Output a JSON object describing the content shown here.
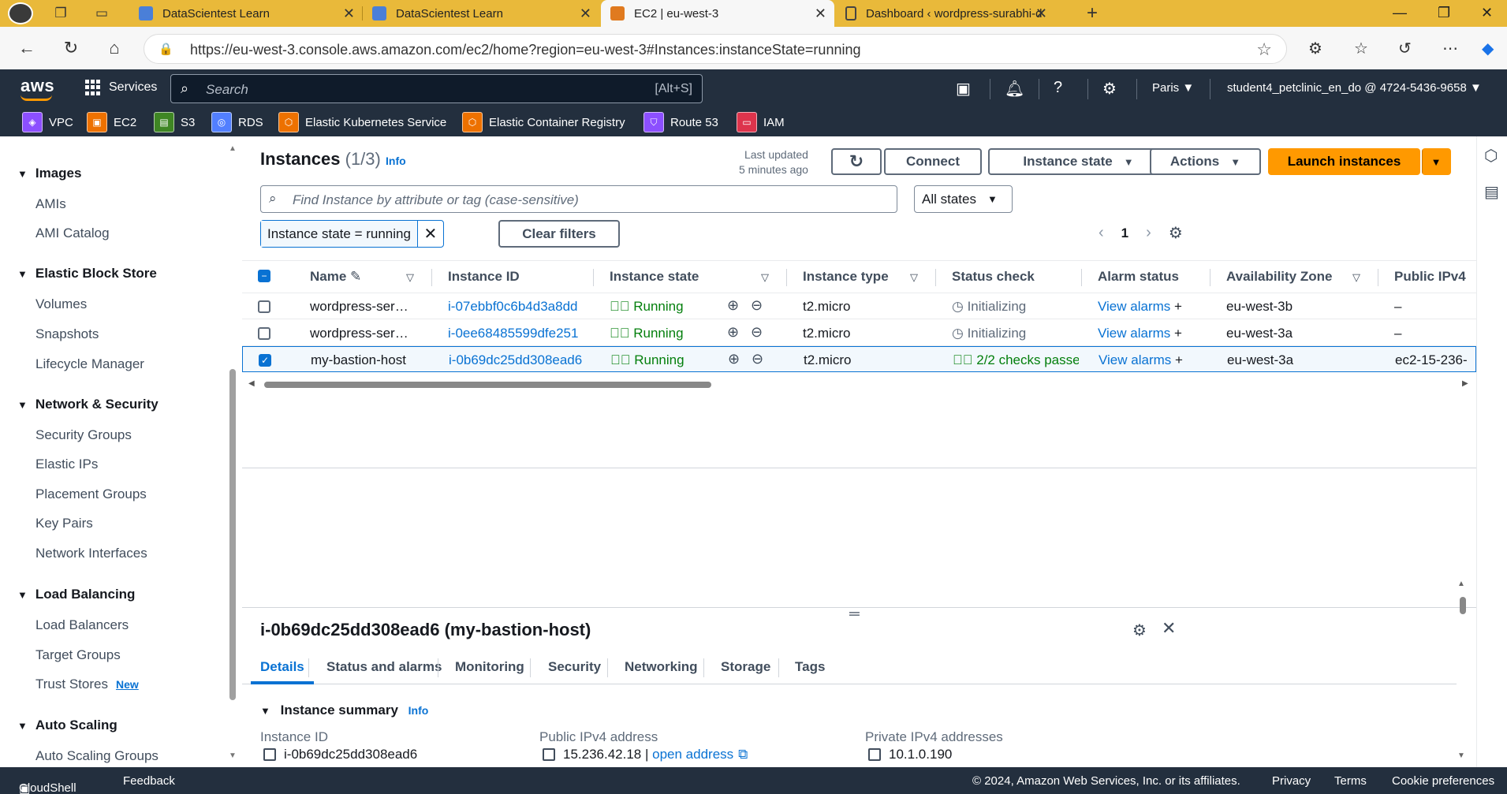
{
  "browser": {
    "tabs": [
      {
        "title": "DataScientest Learn",
        "favicon_color": "#4a7fd8"
      },
      {
        "title": "DataScientest Learn",
        "favicon_color": "#4a7fd8"
      },
      {
        "title": "EC2 | eu-west-3",
        "favicon_color": "#e07a1f"
      },
      {
        "title": "Dashboard ‹ wordpress-surabhi-d",
        "favicon_color": "#777777"
      }
    ],
    "new_tab": "+",
    "url": "https://eu-west-3.console.aws.amazon.com/ec2/home?region=eu-west-3#Instances:instanceState=running"
  },
  "aws": {
    "logo": "aws",
    "services_label": "Services",
    "search_placeholder": "Search",
    "search_shortcut": "[Alt+S]",
    "region": "Paris ▼",
    "account": "student4_petclinic_en_do @ 4724-5436-9658 ▼",
    "favorites": [
      {
        "label": "VPC",
        "color": "#8c4fff"
      },
      {
        "label": "EC2",
        "color": "#ed7100"
      },
      {
        "label": "S3",
        "color": "#3f8624"
      },
      {
        "label": "RDS",
        "color": "#527fff"
      },
      {
        "label": "Elastic Kubernetes Service",
        "color": "#ed7100"
      },
      {
        "label": "Elastic Container Registry",
        "color": "#ed7100"
      },
      {
        "label": "Route 53",
        "color": "#8c4fff"
      },
      {
        "label": "IAM",
        "color": "#dd344c"
      }
    ]
  },
  "sidebar": {
    "sections": [
      {
        "title": "Images",
        "items": [
          "AMIs",
          "AMI Catalog"
        ]
      },
      {
        "title": "Elastic Block Store",
        "items": [
          "Volumes",
          "Snapshots",
          "Lifecycle Manager"
        ]
      },
      {
        "title": "Network & Security",
        "items": [
          "Security Groups",
          "Elastic IPs",
          "Placement Groups",
          "Key Pairs",
          "Network Interfaces"
        ]
      },
      {
        "title": "Load Balancing",
        "items": [
          "Load Balancers",
          "Target Groups",
          "Trust Stores"
        ]
      },
      {
        "title": "Auto Scaling",
        "items": [
          "Auto Scaling Groups"
        ]
      }
    ],
    "new_badge": "New"
  },
  "instances": {
    "title": "Instances",
    "count": "(1/3)",
    "info": "Info",
    "last_updated_line1": "Last updated",
    "last_updated_line2": "5 minutes ago",
    "buttons": {
      "connect": "Connect",
      "instance_state": "Instance state",
      "actions": "Actions",
      "launch": "Launch instances"
    },
    "find_placeholder": "Find Instance by attribute or tag (case-sensitive)",
    "states_filter": "All states",
    "active_filter": "Instance state = running",
    "clear_filters": "Clear filters",
    "page": "1",
    "columns": [
      "Name",
      "Instance ID",
      "Instance state",
      "Instance type",
      "Status check",
      "Alarm status",
      "Availability Zone",
      "Public IPv4"
    ],
    "rows": [
      {
        "name": "wordpress-ser…",
        "id": "i-07ebbf0c6b4d3a8dd",
        "state": "Running",
        "type": "t2.micro",
        "status": "Initializing",
        "alarm": "View alarms",
        "az": "eu-west-3b",
        "ipv4": "–",
        "selected": false
      },
      {
        "name": "wordpress-ser…",
        "id": "i-0ee68485599dfe251",
        "state": "Running",
        "type": "t2.micro",
        "status": "Initializing",
        "alarm": "View alarms",
        "az": "eu-west-3a",
        "ipv4": "–",
        "selected": false
      },
      {
        "name": "my-bastion-host",
        "id": "i-0b69dc25dd308ead6",
        "state": "Running",
        "type": "t2.micro",
        "status": "2/2 checks passec",
        "alarm": "View alarms",
        "az": "eu-west-3a",
        "ipv4": "ec2-15-236-",
        "selected": true
      }
    ]
  },
  "details": {
    "title": "i-0b69dc25dd308ead6 (my-bastion-host)",
    "tabs": [
      "Details",
      "Status and alarms",
      "Monitoring",
      "Security",
      "Networking",
      "Storage",
      "Tags"
    ],
    "summary_title": "Instance summary",
    "summary_info": "Info",
    "fields": {
      "instance_id_label": "Instance ID",
      "instance_id_value": "i-0b69dc25dd308ead6",
      "public_ipv4_label": "Public IPv4 address",
      "public_ipv4_value": "15.236.42.18 |",
      "open_address": "open address",
      "private_ipv4_label": "Private IPv4 addresses",
      "private_ipv4_value": "10.1.0.190"
    }
  },
  "footer": {
    "cloudshell": "CloudShell",
    "feedback": "Feedback",
    "copyright": "© 2024, Amazon Web Services, Inc. or its affiliates.",
    "privacy": "Privacy",
    "terms": "Terms",
    "cookie": "Cookie preferences"
  }
}
